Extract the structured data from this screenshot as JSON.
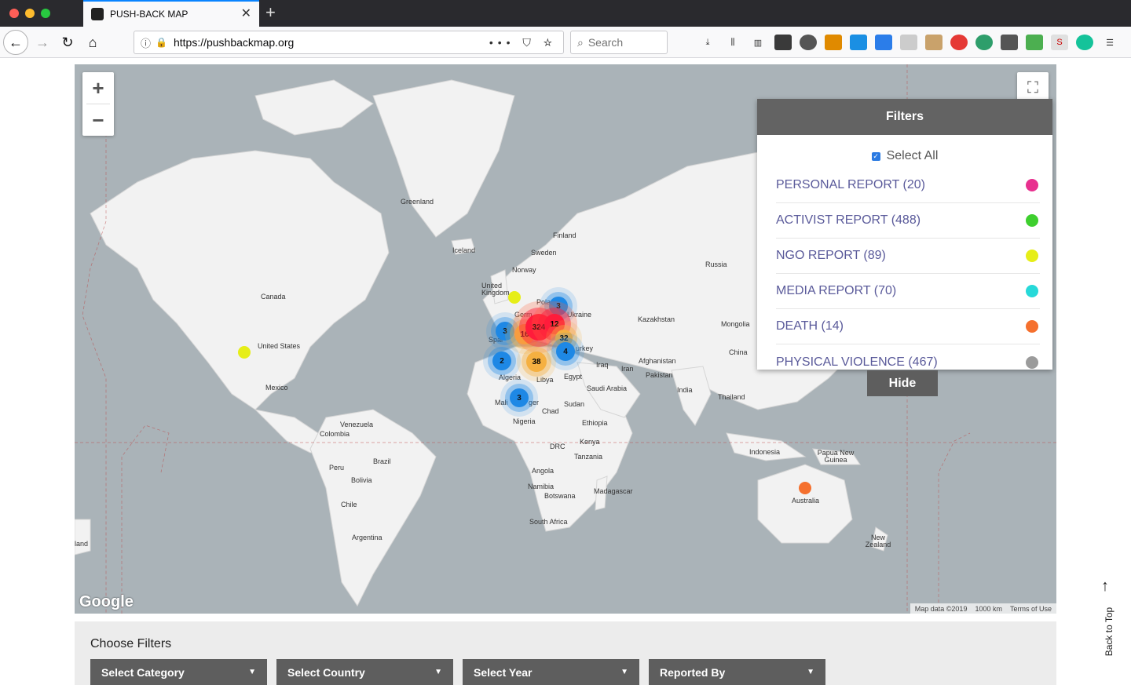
{
  "browser": {
    "tab_title": "PUSH-BACK MAP",
    "url": "https://pushbackmap.org",
    "search_placeholder": "Search"
  },
  "map": {
    "labels": {
      "greenland": "Greenland",
      "iceland": "Iceland",
      "finland": "Finland",
      "sweden": "Sweden",
      "norway": "Norway",
      "russia": "Russia",
      "canada": "Canada",
      "united_states": "United States",
      "mexico": "Mexico",
      "united_kingdom": "United Kingdom",
      "poland": "Pola",
      "germany": "Germ",
      "ukraine": "Ukraine",
      "kazakhstan": "Kazakhstan",
      "mongolia": "Mongolia",
      "china": "China",
      "spain": "Spai",
      "turkey": "urkey",
      "iraq": "Iraq",
      "iran": "Iran",
      "afghanistan": "Afghanistan",
      "pakistan": "Pakistan",
      "india": "India",
      "algeria": "Algeria",
      "libya": "Libya",
      "egypt": "Egypt",
      "saudi_arabia": "Saudi Arabia",
      "mali": "Mali",
      "niger": "ger",
      "chad": "Chad",
      "sudan": "Sudan",
      "nigeria": "Nigeria",
      "ethiopia": "Ethiopia",
      "venezuela": "Venezuela",
      "colombia": "Colombia",
      "brazil": "Brazil",
      "peru": "Peru",
      "bolivia": "Bolivia",
      "chile": "Chile",
      "argentina": "Argentina",
      "kenya": "Kenya",
      "drc": "DRC",
      "tanzania": "Tanzania",
      "angola": "Angola",
      "namibia": "Namibia",
      "botswana": "Botswana",
      "madagascar": "Madagascar",
      "south_africa": "South Africa",
      "thailand": "Thailand",
      "indonesia": "Indonesia",
      "papua_new_guinea": "Papua New Guinea",
      "australia": "Australia",
      "new_zealand": "New Zealand",
      "edge_land": "land"
    },
    "clusters": [
      {
        "count": "3",
        "kind": "blue"
      },
      {
        "count": "3",
        "kind": "blue"
      },
      {
        "count": "324",
        "kind": "red"
      },
      {
        "count": "12",
        "kind": "red"
      },
      {
        "count": "16",
        "kind": "orange"
      },
      {
        "count": "32",
        "kind": "orange"
      },
      {
        "count": "4",
        "kind": "blue"
      },
      {
        "count": "2",
        "kind": "blue"
      },
      {
        "count": "38",
        "kind": "orange"
      },
      {
        "count": "3",
        "kind": "blue"
      }
    ],
    "google_logo": "Google",
    "attribution": {
      "map_data": "Map data ©2019",
      "scale": "1000 km",
      "terms": "Terms of Use"
    },
    "zoom_in": "+",
    "zoom_out": "−"
  },
  "filters": {
    "title": "Filters",
    "select_all": "Select All",
    "items": [
      {
        "label": "PERSONAL REPORT (20)",
        "color": "#e8308f"
      },
      {
        "label": "ACTIVIST REPORT (488)",
        "color": "#3ecf2e"
      },
      {
        "label": "NGO REPORT (89)",
        "color": "#e6ee18"
      },
      {
        "label": "MEDIA REPORT (70)",
        "color": "#27d9d9"
      },
      {
        "label": "DEATH (14)",
        "color": "#f5702e"
      },
      {
        "label": "PHYSICAL VIOLENCE (467)",
        "color": "#9b9b9b"
      }
    ],
    "hide_label": "Hide"
  },
  "choose_filters": {
    "title": "Choose Filters",
    "selects": [
      "Select Category",
      "Select Country",
      "Select Year",
      "Reported By"
    ]
  },
  "back_to_top": "Back to Top"
}
